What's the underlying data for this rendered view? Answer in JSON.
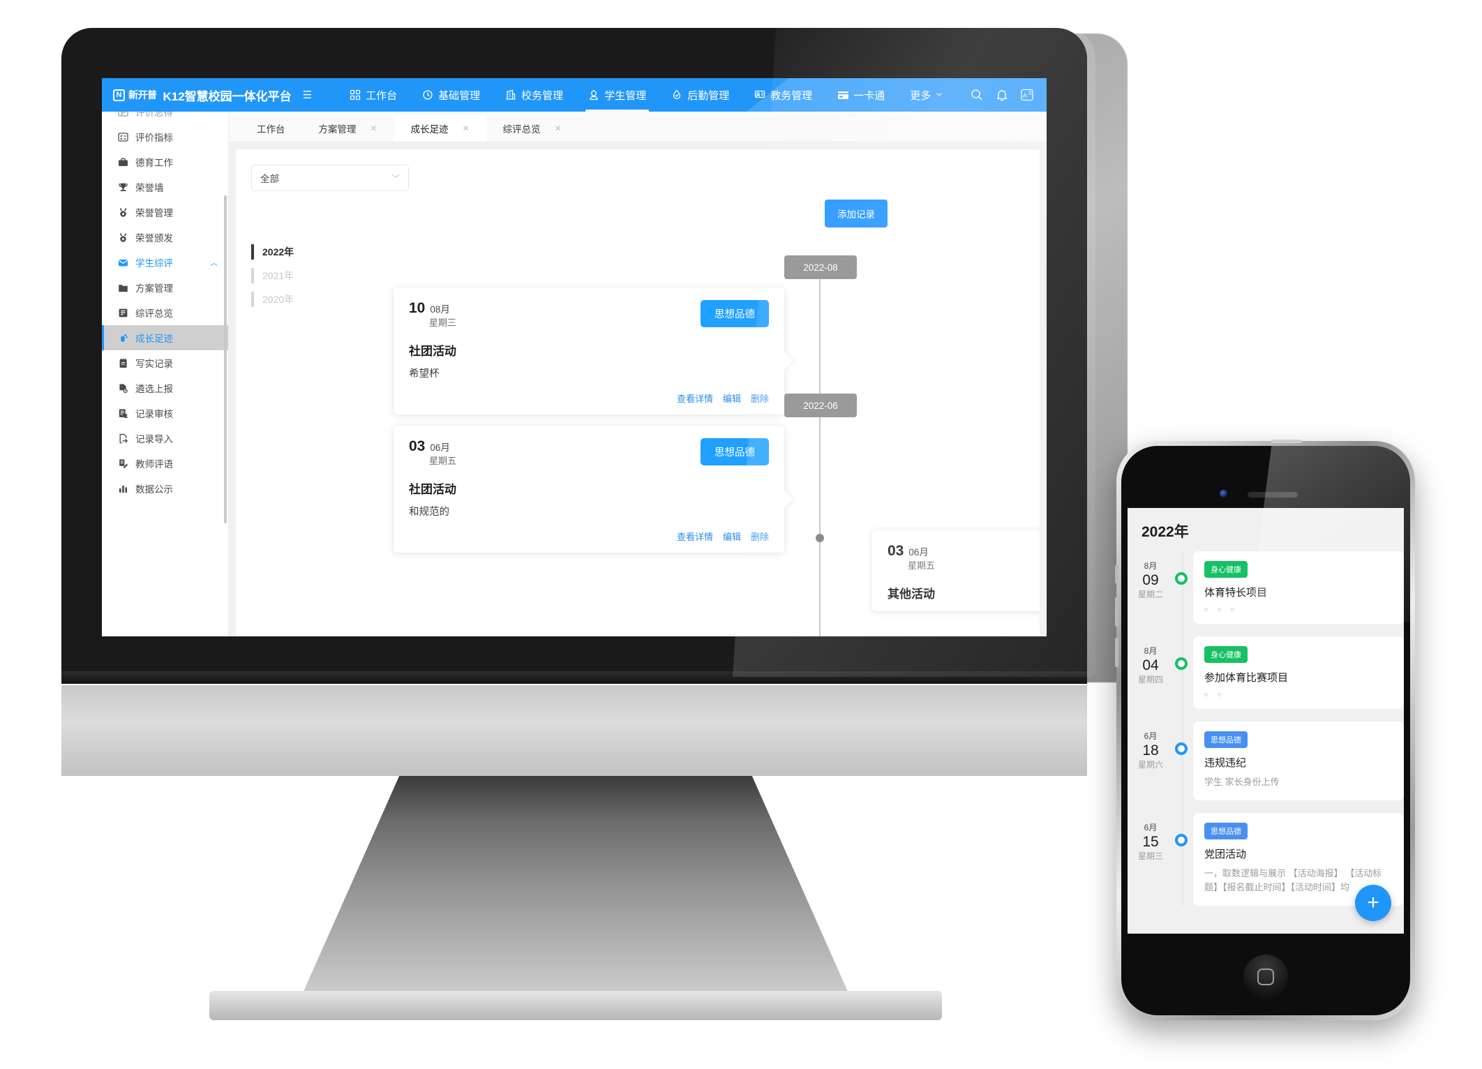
{
  "header": {
    "brand_mark": "N",
    "brand_cn": "新开普",
    "title": "K12智慧校园一体化平台",
    "hamburger": "☰",
    "nav": [
      {
        "label": "工作台",
        "icon": "grid-icon"
      },
      {
        "label": "基础管理",
        "icon": "clock-icon"
      },
      {
        "label": "校务管理",
        "icon": "building-icon"
      },
      {
        "label": "学生管理",
        "icon": "student-icon",
        "active": true
      },
      {
        "label": "后勤管理",
        "icon": "drop-icon"
      },
      {
        "label": "教务管理",
        "icon": "teacher-icon"
      },
      {
        "label": "一卡通",
        "icon": "card-icon"
      }
    ],
    "more_label": "更多",
    "actions": [
      {
        "name": "search-icon"
      },
      {
        "name": "bell-icon"
      },
      {
        "name": "translate-icon"
      }
    ]
  },
  "sidebar": {
    "items": [
      {
        "label": "评价总得",
        "icon": "list-icon",
        "clipped": true
      },
      {
        "label": "评价指标",
        "icon": "checklist-icon"
      },
      {
        "label": "德育工作",
        "icon": "briefcase-icon"
      },
      {
        "label": "荣誉墙",
        "icon": "trophy-icon"
      },
      {
        "label": "荣誉管理",
        "icon": "medal-icon"
      },
      {
        "label": "荣誉颁发",
        "icon": "medal-icon"
      },
      {
        "label": "学生综评",
        "icon": "badge-icon",
        "group": true,
        "expanded": true
      },
      {
        "label": "方案管理",
        "icon": "folder-icon"
      },
      {
        "label": "综评总览",
        "icon": "note-icon"
      },
      {
        "label": "成长足迹",
        "icon": "footprint-icon",
        "active": true
      },
      {
        "label": "写实记录",
        "icon": "notebook-icon"
      },
      {
        "label": "遴选上报",
        "icon": "doc-search-icon"
      },
      {
        "label": "记录审核",
        "icon": "doc-user-icon"
      },
      {
        "label": "记录导入",
        "icon": "import-icon"
      },
      {
        "label": "教师评语",
        "icon": "edit-doc-icon"
      },
      {
        "label": "数据公示",
        "icon": "bar-chart-icon"
      }
    ]
  },
  "tabs": [
    {
      "label": "工作台",
      "closable": false,
      "active": false
    },
    {
      "label": "方案管理",
      "closable": true,
      "active": false
    },
    {
      "label": "成长足迹",
      "closable": true,
      "active": true
    },
    {
      "label": "综评总览",
      "closable": true,
      "active": false
    }
  ],
  "toolbar": {
    "filter_value": "全部",
    "add_record_label": "添加记录"
  },
  "years": [
    {
      "label": "2022年",
      "active": true
    },
    {
      "label": "2021年",
      "active": false
    },
    {
      "label": "2020年",
      "active": false
    }
  ],
  "timeline": {
    "chips": [
      "2022-08",
      "2022-06"
    ],
    "cards": [
      {
        "day": "10",
        "month": "08月",
        "weekday": "星期三",
        "tag": "思想品德",
        "title": "社团活动",
        "desc": "希望杯",
        "actions": [
          "查看详情",
          "编辑",
          "删除"
        ]
      },
      {
        "day": "03",
        "month": "06月",
        "weekday": "星期五",
        "tag": "思想品德",
        "title": "社团活动",
        "desc": "和规范的",
        "actions": [
          "查看详情",
          "编辑",
          "删除"
        ]
      },
      {
        "day": "03",
        "month": "06月",
        "weekday": "星期五",
        "title": "其他活动"
      }
    ]
  },
  "phone": {
    "year": "2022年",
    "fab_label": "+",
    "items": [
      {
        "month": "8月",
        "day": "09",
        "weekday": "星期二",
        "badge": "身心健康",
        "badge_color": "#16c064",
        "dot_color": "#16c064",
        "title": "体育特长项目",
        "sub": "",
        "dots": 3
      },
      {
        "month": "8月",
        "day": "04",
        "weekday": "星期四",
        "badge": "身心健康",
        "badge_color": "#16c064",
        "dot_color": "#16c064",
        "title": "参加体育比赛项目",
        "sub": "",
        "dots": 2
      },
      {
        "month": "6月",
        "day": "18",
        "weekday": "星期六",
        "badge": "思想品德",
        "badge_color": "#4a90f0",
        "dot_color": "#2196f9",
        "title": "违规违纪",
        "sub": "学生 家长身份上传",
        "dots": 0
      },
      {
        "month": "6月",
        "day": "15",
        "weekday": "星期三",
        "badge": "思想品德",
        "badge_color": "#4a90f0",
        "dot_color": "#2196f9",
        "title": "党团活动",
        "sub": "一，取数逻辑与展示 【活动海报】 【活动标题】【报名截止时间】【活动时间】均",
        "dots": 0
      }
    ]
  },
  "colors": {
    "brand_blue": "#2196f9",
    "button_blue": "#1890ff",
    "tag_blue": "#20a0ff",
    "green": "#16c064",
    "chip_gray": "#9a9a9a"
  }
}
